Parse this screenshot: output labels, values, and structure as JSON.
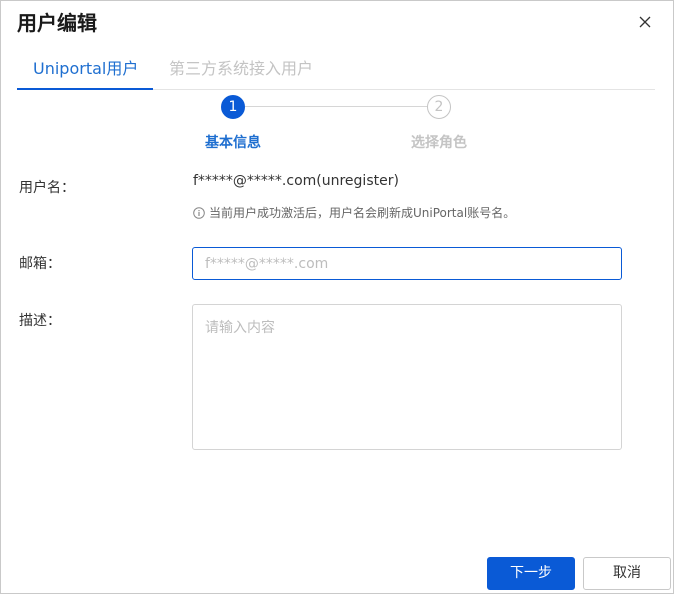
{
  "dialog": {
    "title": "用户编辑",
    "close_icon": "close-icon"
  },
  "tabs": [
    {
      "label": "Uniportal用户",
      "active": true
    },
    {
      "label": "第三方系统接入用户",
      "active": false
    }
  ],
  "steps": [
    {
      "number": "1",
      "label": "基本信息",
      "state": "done"
    },
    {
      "number": "2",
      "label": "选择角色",
      "state": "todo"
    }
  ],
  "form": {
    "username_label": "用户名：",
    "username_value": "f*****@*****.com(unregister)",
    "username_hint": "当前用户成功激活后，用户名会刷新成UniPortal账号名。",
    "hint_icon": "info-icon",
    "email_label": "邮箱：",
    "email_placeholder": "f*****@*****.com",
    "description_label": "描述：",
    "description_placeholder": "请输入内容"
  },
  "footer": {
    "next_label": "下一步",
    "cancel_label": "取消"
  },
  "colors": {
    "primary": "#0a5ad6",
    "tab_active_text": "#1f6fd0",
    "inactive": "#c4c4c4"
  }
}
